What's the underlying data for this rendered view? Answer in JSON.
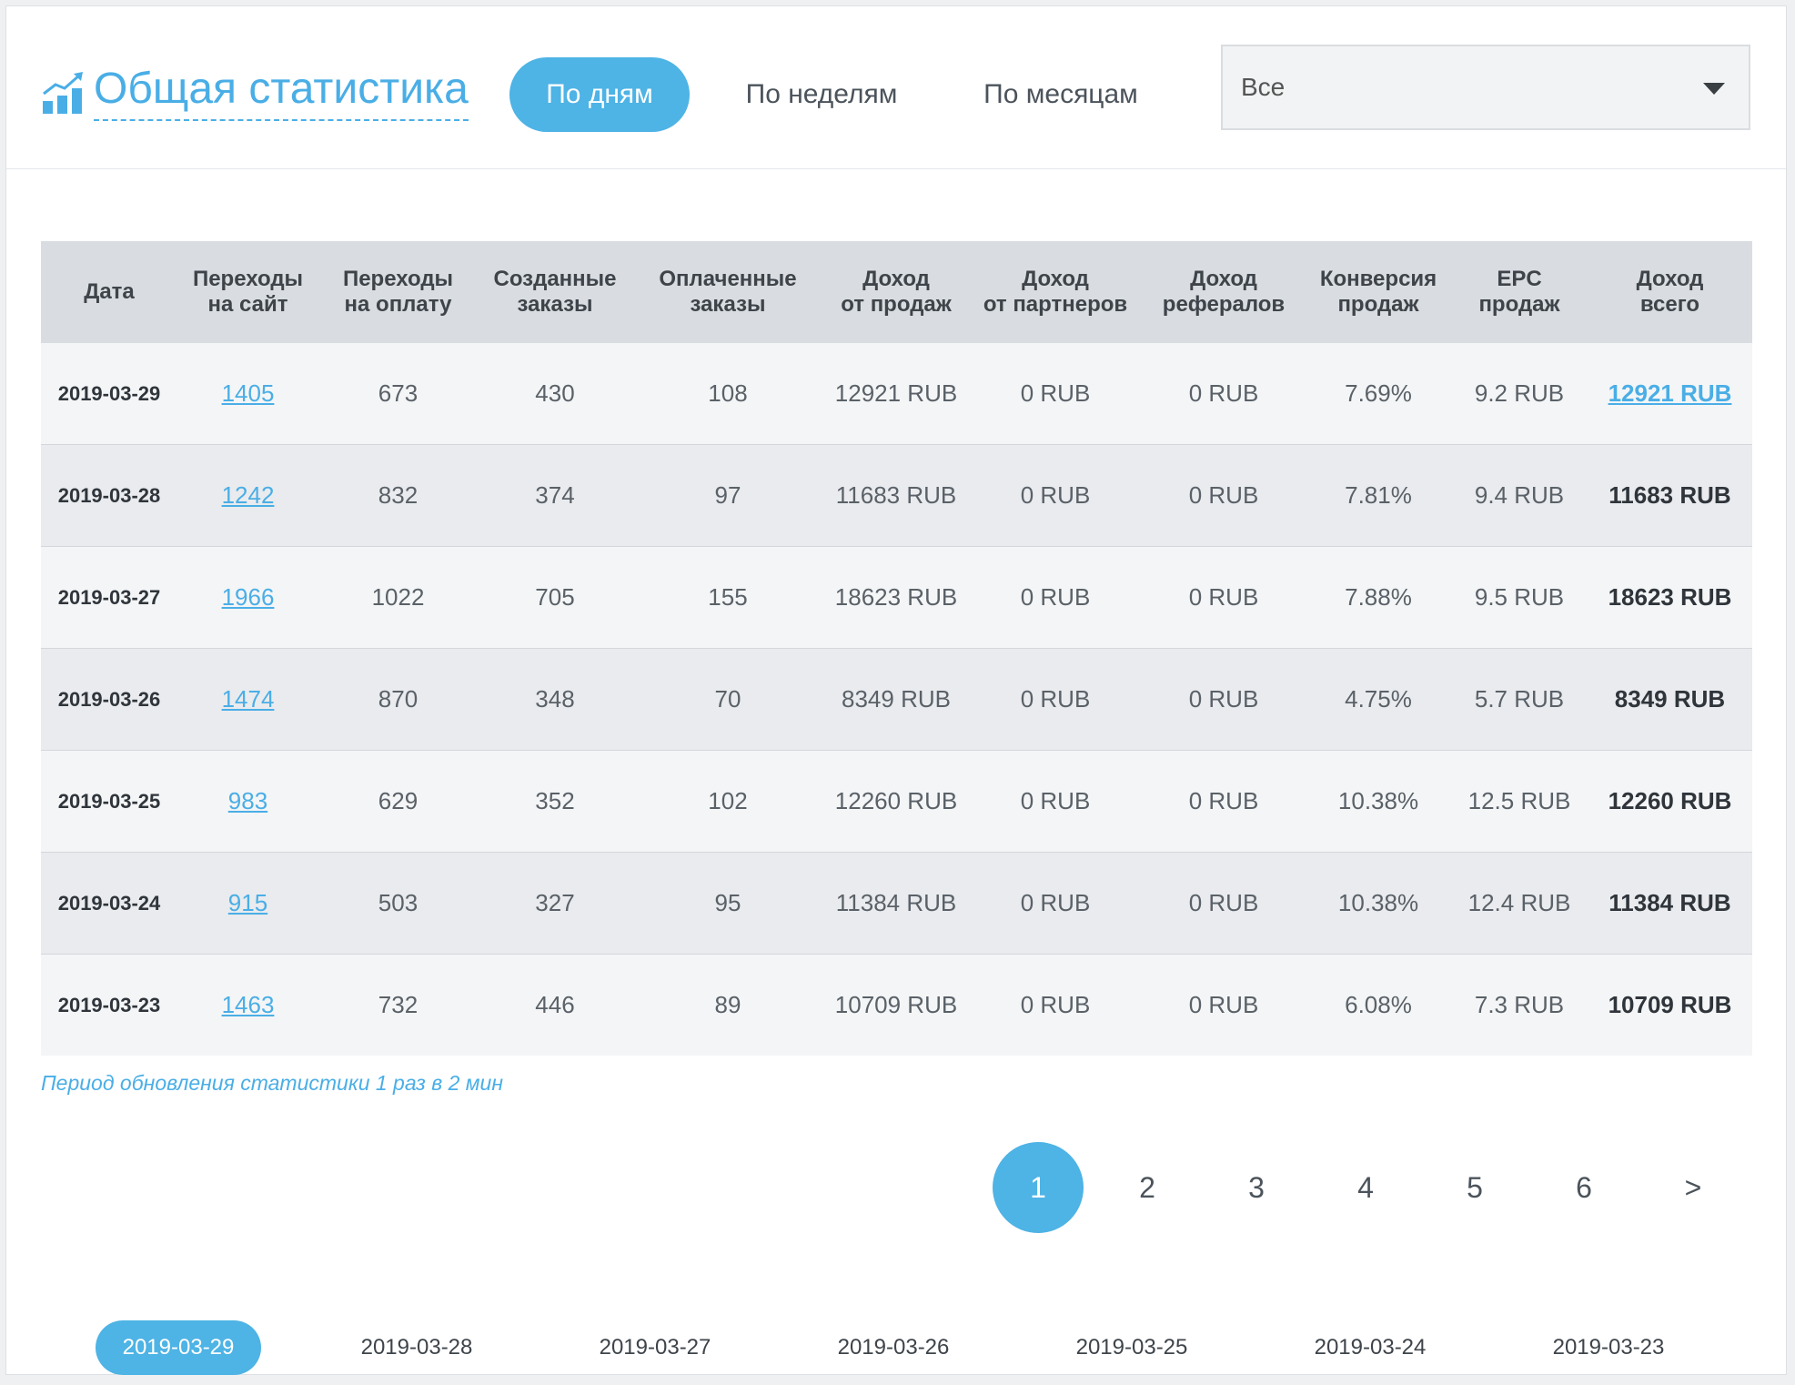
{
  "header": {
    "title": "Общая статистика",
    "tabs": [
      "По дням",
      "По неделям",
      "По месяцам"
    ],
    "active_tab": 0,
    "select_value": "Все"
  },
  "table": {
    "columns": [
      [
        "Дата"
      ],
      [
        "Переходы",
        "на сайт"
      ],
      [
        "Переходы",
        "на оплату"
      ],
      [
        "Созданные",
        "заказы"
      ],
      [
        "Оплаченные",
        "заказы"
      ],
      [
        "Доход",
        "от продаж"
      ],
      [
        "Доход",
        "от партнеров"
      ],
      [
        "Доход",
        "рефералов"
      ],
      [
        "Конверсия",
        "продаж"
      ],
      [
        "EPC",
        "продаж"
      ],
      [
        "Доход",
        "всего"
      ]
    ],
    "rows": [
      [
        "2019-03-29",
        "1405",
        "673",
        "430",
        "108",
        "12921 RUB",
        "0 RUB",
        "0 RUB",
        "7.69%",
        "9.2 RUB",
        "12921 RUB"
      ],
      [
        "2019-03-28",
        "1242",
        "832",
        "374",
        "97",
        "11683 RUB",
        "0 RUB",
        "0 RUB",
        "7.81%",
        "9.4 RUB",
        "11683 RUB"
      ],
      [
        "2019-03-27",
        "1966",
        "1022",
        "705",
        "155",
        "18623 RUB",
        "0 RUB",
        "0 RUB",
        "7.88%",
        "9.5 RUB",
        "18623 RUB"
      ],
      [
        "2019-03-26",
        "1474",
        "870",
        "348",
        "70",
        "8349 RUB",
        "0 RUB",
        "0 RUB",
        "4.75%",
        "5.7 RUB",
        "8349 RUB"
      ],
      [
        "2019-03-25",
        "983",
        "629",
        "352",
        "102",
        "12260 RUB",
        "0 RUB",
        "0 RUB",
        "10.38%",
        "12.5 RUB",
        "12260 RUB"
      ],
      [
        "2019-03-24",
        "915",
        "503",
        "327",
        "95",
        "11384 RUB",
        "0 RUB",
        "0 RUB",
        "10.38%",
        "12.4 RUB",
        "11384 RUB"
      ],
      [
        "2019-03-23",
        "1463",
        "732",
        "446",
        "89",
        "10709 RUB",
        "0 RUB",
        "0 RUB",
        "6.08%",
        "7.3 RUB",
        "10709 RUB"
      ]
    ]
  },
  "note": "Период обновления статистики 1 раз в 2 мин",
  "pagination": {
    "pages": [
      "1",
      "2",
      "3",
      "4",
      "5",
      "6",
      ">"
    ],
    "active": 0
  },
  "date_tabs": {
    "items": [
      "2019-03-29",
      "2019-03-28",
      "2019-03-27",
      "2019-03-26",
      "2019-03-25",
      "2019-03-24",
      "2019-03-23"
    ],
    "active": 0
  },
  "colors": {
    "accent": "#4eb3e5",
    "link": "#4aaee6",
    "header_bg": "#d9dde1"
  }
}
